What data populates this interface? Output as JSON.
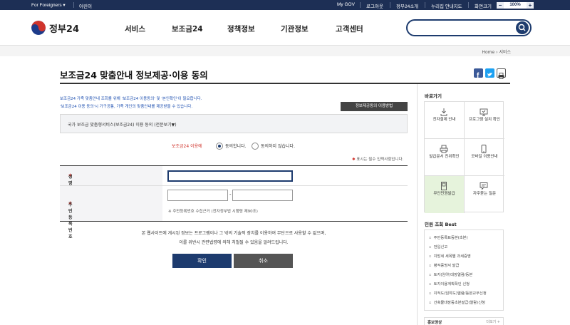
{
  "topbar": {
    "foreigners": "For Foreigners ▾",
    "kids": "어린이",
    "my_gov": "My GOV",
    "logout": "로그아웃",
    "intro": "정부24소개",
    "sitemap": "누리집 안내지도",
    "screen_size": "화면크기",
    "zoom_minus": "−",
    "zoom_value": "100%",
    "zoom_plus": "+"
  },
  "header": {
    "logo_text": "정부24",
    "nav": [
      "서비스",
      "보조금24",
      "정책정보",
      "기관정보",
      "고객센터"
    ]
  },
  "breadcrumb": {
    "home": "Home",
    "current": "서비스"
  },
  "page": {
    "title": "보조금24 맞춤안내 정보제공·이용 동의",
    "info1": "보조금24 가족 맞춤안내 조회를 위해 '보조금24 이용동의' 및 '본인확인'이 필요합니다.",
    "info2": "'보조금24 이용 동의'시 가구공통, 가족 개인의 맞춤안내를 제공받을 수 있습니다.",
    "method_button": "정보제공동의 이용방법",
    "agree_text": "국가 보조금 맞춤형서비스(보조금24) 이용 동의 (전문보기▼)",
    "radio_label": "보조금24 이용에",
    "radio_agree": "동의합니다.",
    "radio_disagree": "동의하지 않습니다.",
    "required_note": "표시는 필수 입력사항입니다.",
    "name_label": "성명",
    "rrn_label": "주민등록번호",
    "rrn_sep": "-",
    "rrn_note": "※ 주민등록번호 수집근거 (전자정부법 시행령 제90조)",
    "notice1": "본 웹사이트에 게시된 정보는 프로그램이나 그 밖의 기술적 장치를 이용하여 무단으로 사용할 수 없으며,",
    "notice2": "이를 위반시 관련법령에 의해 처벌될 수 있음을 알려드립니다.",
    "confirm": "확인",
    "cancel": "취소"
  },
  "sidebar": {
    "quick_title": "바로가기",
    "quick": [
      "전자결제 안내",
      "프로그램 설치 확인",
      "발급문서 진위확인",
      "모바일 이용안내",
      "무인민원발급",
      "자주묻는 질문"
    ],
    "best_title": "민원 조회 Best",
    "best": [
      "주민등록표등본(초본)",
      "전입신고",
      "지방세 세목별 과세증명",
      "병적증명서 발급",
      "토지(임야)대장열람/등본",
      "토지이용계획확인 신청",
      "지적도(임야도)열람/등본교부신청",
      "건축물대장등초본발급(열람)신청"
    ],
    "promo_title": "홍보영상",
    "promo_more": "더보기 +"
  },
  "colors": {
    "navy": "#1d2f55",
    "accent": "#1d3b6e",
    "info_blue": "#1d4fb0",
    "required_red": "#d0342c"
  }
}
